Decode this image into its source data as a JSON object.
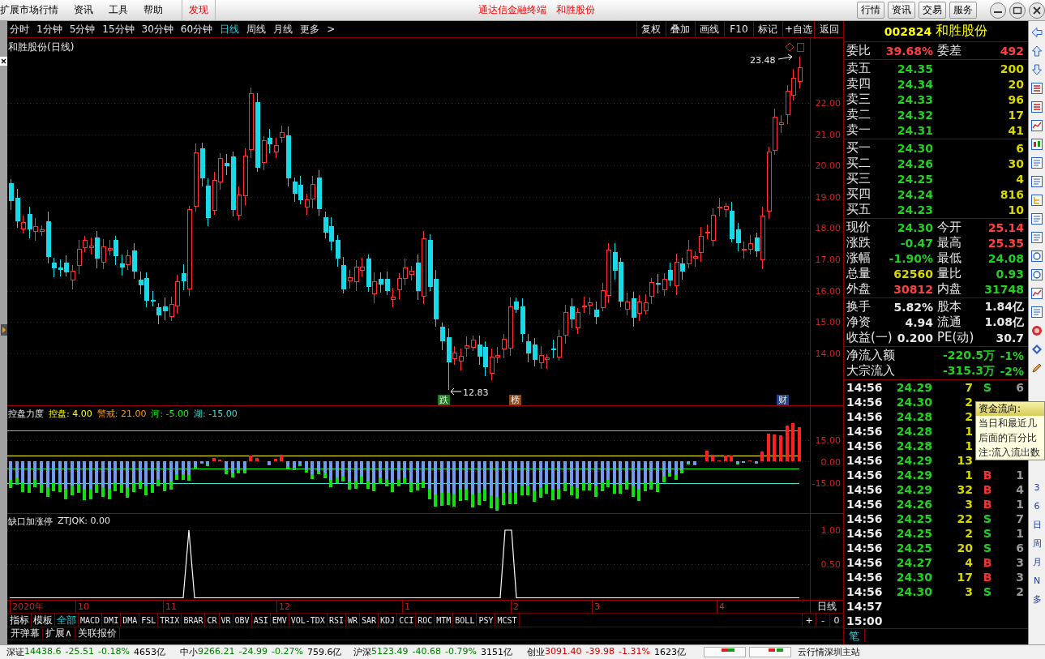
{
  "menu_bar": {
    "items": [
      {
        "label": "扩展市场行情",
        "kind": "menu"
      },
      {
        "label": "资讯",
        "kind": "menu"
      },
      {
        "label": "工具",
        "kind": "menu"
      },
      {
        "label": "帮助",
        "kind": "menu"
      },
      {
        "label": "发现",
        "kind": "highlight"
      }
    ],
    "title": "通达信金融终端",
    "stock": "和胜股份",
    "buttons": [
      "行情",
      "资讯",
      "交易",
      "服务"
    ]
  },
  "period_bar": {
    "periods": [
      {
        "label": "分时",
        "selected": false
      },
      {
        "label": "1分钟",
        "selected": false
      },
      {
        "label": "5分钟",
        "selected": false
      },
      {
        "label": "15分钟",
        "selected": false
      },
      {
        "label": "30分钟",
        "selected": false
      },
      {
        "label": "60分钟",
        "selected": false
      },
      {
        "label": "日线",
        "selected": true
      },
      {
        "label": "周线",
        "selected": false
      },
      {
        "label": "月线",
        "selected": false
      },
      {
        "label": "更多",
        "selected": false
      }
    ],
    "more_arrow": ">",
    "tools": [
      "复权",
      "叠加",
      "画线",
      "F10",
      "标记",
      "+自选",
      "返回"
    ]
  },
  "main_chart": {
    "title": "和胜股份(日线)",
    "price_ticks": [
      "22.00",
      "21.00",
      "20.00",
      "19.00",
      "18.00",
      "17.00",
      "16.00",
      "15.00",
      "14.00"
    ],
    "high_label": "23.48",
    "low_label": "12.83",
    "markers": [
      {
        "label": "跌",
        "color": "#1e7a1e"
      },
      {
        "label": "榜",
        "color": "#8a4a1a"
      },
      {
        "label": "财",
        "color": "#24468c"
      }
    ]
  },
  "indicator_1": {
    "name": "控盘力度",
    "params": [
      {
        "label": "控盘: 4.00",
        "color": "#ffff00"
      },
      {
        "label": "警戒: 21.00",
        "color": "#ff9900"
      },
      {
        "label": "河: -5.00",
        "color": "#00ff00"
      },
      {
        "label": "湖: -15.00",
        "color": "#40e0d0"
      }
    ],
    "ticks": [
      "15.00",
      "0.00",
      "-15.00"
    ]
  },
  "indicator_2": {
    "name": "缺口加涨停",
    "value_label": "ZTJQK: 0.00",
    "ticks": [
      "1.00",
      "0.50"
    ]
  },
  "date_axis": {
    "labels": [
      "2020年",
      "10",
      "11",
      "12",
      "1",
      "2",
      "3",
      "4"
    ],
    "period": "日线"
  },
  "indicator_tabs": {
    "tabs": [
      {
        "label": "指标",
        "kind": "menu",
        "selected": false
      },
      {
        "label": "模板",
        "kind": "menu",
        "selected": false
      },
      {
        "label": "全部",
        "kind": "menu",
        "selected": true
      },
      {
        "label": "MACD",
        "kind": "indicator",
        "selected": false
      },
      {
        "label": "DMI",
        "kind": "indicator",
        "selected": false
      },
      {
        "label": "DMA",
        "kind": "indicator",
        "selected": false
      },
      {
        "label": "FSL",
        "kind": "indicator",
        "selected": false
      },
      {
        "label": "TRIX",
        "kind": "indicator",
        "selected": false
      },
      {
        "label": "BRAR",
        "kind": "indicator",
        "selected": false
      },
      {
        "label": "CR",
        "kind": "indicator",
        "selected": false
      },
      {
        "label": "VR",
        "kind": "indicator",
        "selected": false
      },
      {
        "label": "OBV",
        "kind": "indicator",
        "selected": false
      },
      {
        "label": "ASI",
        "kind": "indicator",
        "selected": false
      },
      {
        "label": "EMV",
        "kind": "indicator",
        "selected": false
      },
      {
        "label": "VOL-TDX",
        "kind": "indicator",
        "selected": false
      },
      {
        "label": "RSI",
        "kind": "indicator",
        "selected": false
      },
      {
        "label": "WR",
        "kind": "indicator",
        "selected": false
      },
      {
        "label": "SAR",
        "kind": "indicator",
        "selected": false
      },
      {
        "label": "KDJ",
        "kind": "indicator",
        "selected": false
      },
      {
        "label": "CCI",
        "kind": "indicator",
        "selected": false
      },
      {
        "label": "ROC",
        "kind": "indicator",
        "selected": false
      },
      {
        "label": "MTM",
        "kind": "indicator",
        "selected": false
      },
      {
        "label": "BOLL",
        "kind": "indicator",
        "selected": false
      },
      {
        "label": "PSY",
        "kind": "indicator",
        "selected": false
      },
      {
        "label": "MCST",
        "kind": "indicator",
        "selected": false
      }
    ],
    "zoom": [
      "+",
      "-",
      "0"
    ]
  },
  "extra_tabs": [
    "开弹幕",
    "扩展∧",
    "关联报价"
  ],
  "quote": {
    "code": "002824",
    "name": "和胜股份",
    "order_ratio": [
      {
        "label": "委比",
        "value": "39.68%",
        "color": "#ff4040"
      },
      {
        "label": "委差",
        "value": "492",
        "color": "#ff4040"
      }
    ],
    "asks": [
      {
        "label": "卖五",
        "price": "24.35",
        "volume": "200"
      },
      {
        "label": "卖四",
        "price": "24.34",
        "volume": "20"
      },
      {
        "label": "卖三",
        "price": "24.33",
        "volume": "96"
      },
      {
        "label": "卖二",
        "price": "24.32",
        "volume": "17"
      },
      {
        "label": "卖一",
        "price": "24.31",
        "volume": "41"
      }
    ],
    "bids": [
      {
        "label": "买一",
        "price": "24.30",
        "volume": "6"
      },
      {
        "label": "买二",
        "price": "24.26",
        "volume": "30"
      },
      {
        "label": "买三",
        "price": "24.25",
        "volume": "4"
      },
      {
        "label": "买四",
        "price": "24.24",
        "volume": "816"
      },
      {
        "label": "买五",
        "price": "24.23",
        "volume": "10"
      }
    ],
    "stats": [
      {
        "label": "现价",
        "value": "24.30",
        "color": "#1ed21e"
      },
      {
        "label": "今开",
        "value": "25.14",
        "color": "#ff4040"
      },
      {
        "label": "涨跌",
        "value": "-0.47",
        "color": "#1ed21e"
      },
      {
        "label": "最高",
        "value": "25.35",
        "color": "#ff4040"
      },
      {
        "label": "涨幅",
        "value": "-1.90%",
        "color": "#1ed21e"
      },
      {
        "label": "最低",
        "value": "24.08",
        "color": "#1ed21e"
      },
      {
        "label": "总量",
        "value": "62560",
        "color": "#d8d800"
      },
      {
        "label": "量比",
        "value": "0.93",
        "color": "#1ed21e"
      },
      {
        "label": "外盘",
        "value": "30812",
        "color": "#ff4040"
      },
      {
        "label": "内盘",
        "value": "31748",
        "color": "#1ed21e"
      }
    ],
    "fundamentals": [
      {
        "label": "换手",
        "value": "5.82%"
      },
      {
        "label": "股本",
        "value": "1.84亿"
      },
      {
        "label": "净资",
        "value": "4.94"
      },
      {
        "label": "流通",
        "value": "1.08亿"
      },
      {
        "label": "收益(一)",
        "value": "0.200"
      },
      {
        "label": "PE(动)",
        "value": "30.7"
      }
    ],
    "flows": [
      {
        "label": "净流入额",
        "amount": "-220.5万",
        "percent": "-1%"
      },
      {
        "label": "大宗流入",
        "amount": "-315.3万",
        "percent": "-2%"
      }
    ]
  },
  "trades": {
    "rows": [
      {
        "time": "14:56",
        "price": "24.29",
        "volume": "7",
        "side": {
          "label": "S",
          "color": "#1ed21e"
        },
        "count": "6"
      },
      {
        "time": "14:56",
        "price": "24.30",
        "volume": "2"
      },
      {
        "time": "14:56",
        "price": "24.28",
        "volume": "2"
      },
      {
        "time": "14:56",
        "price": "24.28",
        "volume": "1"
      },
      {
        "time": "14:56",
        "price": "24.28",
        "volume": "1"
      },
      {
        "time": "14:56",
        "price": "24.29",
        "volume": "13"
      },
      {
        "time": "14:56",
        "price": "24.29",
        "volume": "1",
        "side": {
          "label": "B",
          "color": "#ff3030"
        },
        "count": "1"
      },
      {
        "time": "14:56",
        "price": "24.29",
        "volume": "32",
        "side": {
          "label": "B",
          "color": "#ff3030"
        },
        "count": "4"
      },
      {
        "time": "14:56",
        "price": "24.26",
        "volume": "3",
        "side": {
          "label": "B",
          "color": "#ff3030"
        },
        "count": "1"
      },
      {
        "time": "14:56",
        "price": "24.25",
        "volume": "22",
        "side": {
          "label": "S",
          "color": "#1ed21e"
        },
        "count": "7"
      },
      {
        "time": "14:56",
        "price": "24.25",
        "volume": "2",
        "side": {
          "label": "S",
          "color": "#1ed21e"
        },
        "count": "1"
      },
      {
        "time": "14:56",
        "price": "24.25",
        "volume": "20",
        "side": {
          "label": "S",
          "color": "#1ed21e"
        },
        "count": "6"
      },
      {
        "time": "14:56",
        "price": "24.27",
        "volume": "4",
        "side": {
          "label": "B",
          "color": "#ff3030"
        },
        "count": "3"
      },
      {
        "time": "14:56",
        "price": "24.30",
        "volume": "17",
        "side": {
          "label": "B",
          "color": "#ff3030"
        },
        "count": "3"
      },
      {
        "time": "14:56",
        "price": "24.30",
        "volume": "3",
        "side": {
          "label": "S",
          "color": "#1ed21e"
        },
        "count": "2"
      },
      {
        "time": "14:57"
      },
      {
        "time": "15:00"
      }
    ],
    "tab": "笔"
  },
  "tooltip": {
    "title": "资金流向:",
    "lines": [
      "当日和最近几",
      "后面的百分比",
      "注:流入流出数"
    ]
  },
  "side_strip": {
    "labels": [
      "3",
      "6",
      "日",
      "周",
      "月",
      "N",
      "多"
    ]
  },
  "status_bar": {
    "indices": [
      {
        "name": "深证",
        "value": "14438.6",
        "change": "-25.51",
        "percent": "-0.18%",
        "amount": "4653亿",
        "color": "#008000"
      },
      {
        "name": "中小",
        "value": "9266.21",
        "change": "-24.99",
        "percent": "-0.27%",
        "amount": "759.6亿",
        "color": "#008000"
      },
      {
        "name": "沪深",
        "value": "5123.49",
        "change": "-40.68",
        "percent": "-0.79%",
        "amount": "3151亿",
        "color": "#008000"
      },
      {
        "name": "创业",
        "value": "3091.40",
        "change": "-39.98",
        "percent": "-1.31%",
        "amount": "1623亿",
        "color": "#d00000"
      }
    ],
    "server": "云行情深圳主站"
  }
}
